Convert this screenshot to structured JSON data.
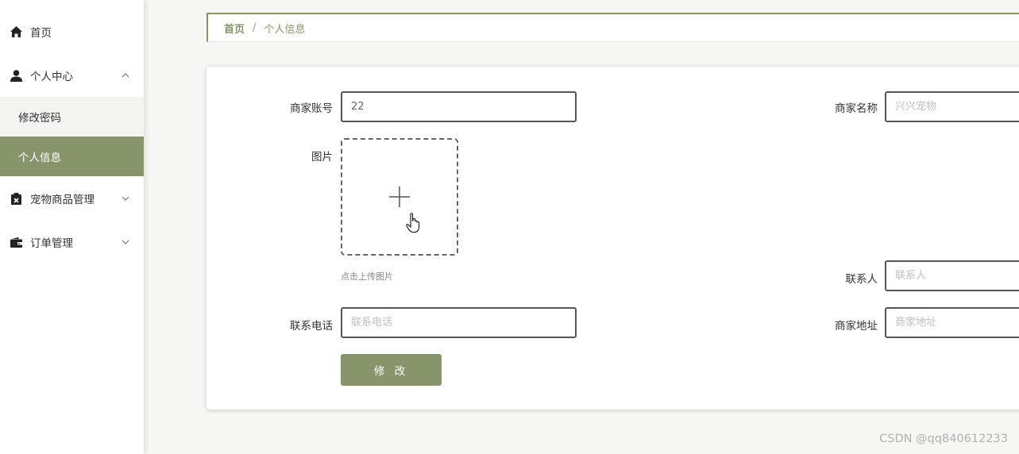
{
  "sidebar": {
    "items": [
      {
        "label": "首页",
        "icon": "home-icon"
      },
      {
        "label": "个人中心",
        "icon": "user-icon",
        "expanded": true,
        "children": [
          {
            "label": "修改密码"
          },
          {
            "label": "个人信息",
            "active": true
          }
        ]
      },
      {
        "label": "宠物商品管理",
        "icon": "clipboard-icon",
        "expanded": false
      },
      {
        "label": "订单管理",
        "icon": "wallet-icon",
        "expanded": false
      }
    ]
  },
  "breadcrumb": {
    "home": "首页",
    "separator": "/",
    "current": "个人信息"
  },
  "form": {
    "account": {
      "label": "商家账号",
      "value": "22"
    },
    "name": {
      "label": "商家名称",
      "placeholder": "兴兴宠物"
    },
    "image": {
      "label": "图片",
      "tip": "点击上传图片"
    },
    "contact": {
      "label": "联系人",
      "placeholder": "联系人"
    },
    "phone": {
      "label": "联系电话",
      "placeholder": "联系电话"
    },
    "address": {
      "label": "商家地址",
      "placeholder": "商家地址"
    },
    "submit_label": "修 改"
  },
  "watermark": "CSDN @qq840612233",
  "colors": {
    "accent": "#88956a",
    "active_text": "#ffffff"
  }
}
